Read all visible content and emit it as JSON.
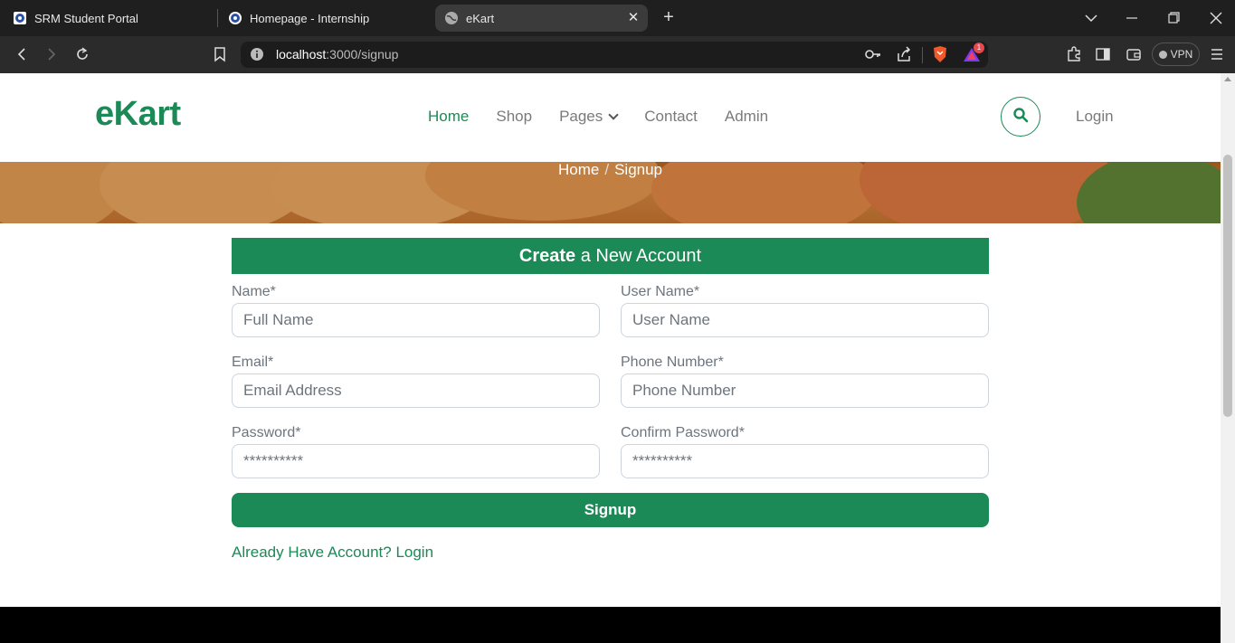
{
  "browser": {
    "tabs": [
      {
        "title": "SRM Student Portal"
      },
      {
        "title": "Homepage - Internship"
      },
      {
        "title": "eKart"
      }
    ],
    "url_host": "localhost",
    "url_path": ":3000/signup",
    "vpn_label": "VPN",
    "notification_count": "1"
  },
  "site": {
    "logo": "eKart",
    "nav": {
      "home": "Home",
      "shop": "Shop",
      "pages": "Pages",
      "contact": "Contact",
      "admin": "Admin"
    },
    "login": "Login",
    "accent_color": "#1b8a56"
  },
  "breadcrumb": {
    "home": "Home",
    "separator": "/",
    "current": "Signup"
  },
  "form": {
    "title_bold": "Create",
    "title_rest": " a New Account",
    "name": {
      "label": "Name*",
      "placeholder": "Full Name"
    },
    "username": {
      "label": "User Name*",
      "placeholder": "User Name"
    },
    "email": {
      "label": "Email*",
      "placeholder": "Email Address"
    },
    "phone": {
      "label": "Phone Number*",
      "placeholder": "Phone Number"
    },
    "password": {
      "label": "Password*",
      "placeholder": "**********"
    },
    "confirm_password": {
      "label": "Confirm Password*",
      "placeholder": "**********"
    },
    "submit": "Signup",
    "already": "Already Have Account? Login"
  }
}
